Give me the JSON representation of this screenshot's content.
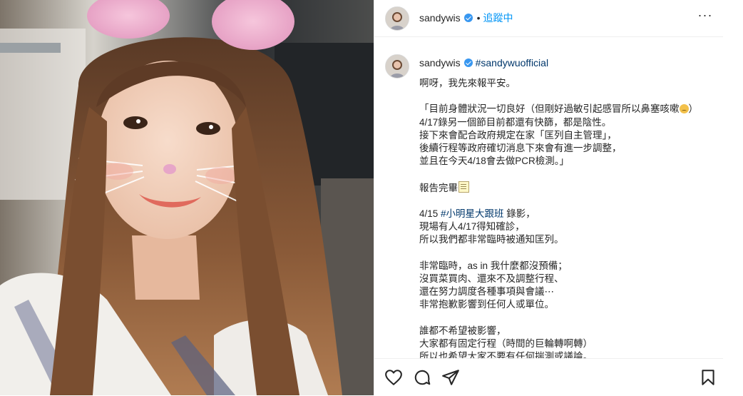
{
  "post": {
    "username": "sandywis",
    "follow_label": "追蹤中",
    "more_label": "···"
  },
  "caption": {
    "username": "sandywis",
    "hashtag": "#sandywuofficial",
    "lines": {
      "l1": "啊呀，我先來報平安。",
      "l2": "「目前身體狀況一切良好（但剛好過敏引起感冒所以鼻塞咳嗽",
      "l2_end": "）",
      "l3": "4/17錄另一個節目前都還有快篩，都是陰性。",
      "l4": "接下來會配合政府規定在家「匡列自主管理」，",
      "l5": "後續行程等政府確切消息下來會有進一步調整，",
      "l6": "並且在今天4/18會去做PCR檢測。」",
      "l7": "報告完畢",
      "l8_a": "4/15 ",
      "l8_tag": "#小明星大跟班",
      "l8_b": " 錄影，",
      "l9": "現場有人4/17得知確診，",
      "l10": "所以我們都非常臨時被通知匡列。",
      "l11": "非常臨時，as in 我什麼都沒預備；",
      "l12": "沒買菜買肉、還來不及調整行程、",
      "l13": "還在努力調度各種事項與會議⋯",
      "l14": "非常抱歉影響到任何人或單位。",
      "l15": "誰都不希望被影響，",
      "l16": "大家都有固定行程（時間的巨輪轉啊轉）",
      "l17": "所以也希望大家不要有任何揣測或議論。"
    }
  },
  "icons": {
    "verified": "verified-badge-icon",
    "like": "heart-icon",
    "comment": "comment-icon",
    "share": "paper-plane-icon",
    "save": "bookmark-icon",
    "memo": "memo-emoji-icon",
    "face": "sad-face-emoji-icon"
  },
  "colors": {
    "link_blue": "#0095f6",
    "hashtag": "#00376b",
    "verified": "#3897f0",
    "text": "#262626"
  }
}
